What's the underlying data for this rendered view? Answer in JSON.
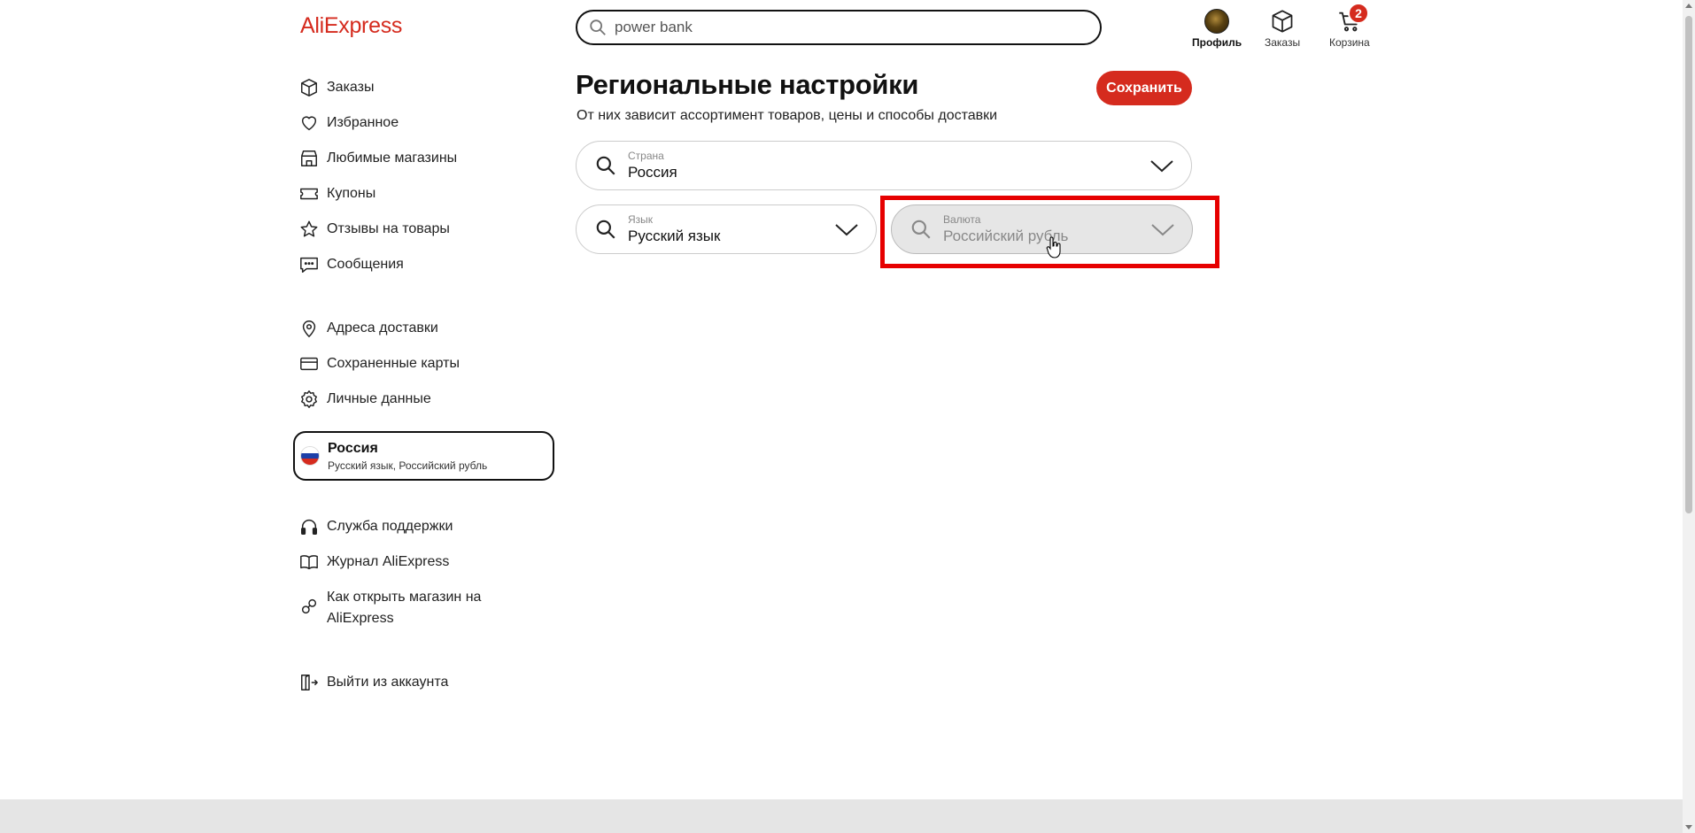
{
  "header": {
    "logo": "AliExpress",
    "search_value": "power bank",
    "profile_label": "Профиль",
    "orders_label": "Заказы",
    "cart_label": "Корзина",
    "cart_count": "2"
  },
  "sidebar": {
    "group1": [
      {
        "label": "Заказы",
        "icon": "box-icon"
      },
      {
        "label": "Избранное",
        "icon": "heart-icon"
      },
      {
        "label": "Любимые магазины",
        "icon": "store-icon"
      },
      {
        "label": "Купоны",
        "icon": "coupon-icon"
      },
      {
        "label": "Отзывы на товары",
        "icon": "star-icon"
      },
      {
        "label": "Сообщения",
        "icon": "chat-icon"
      }
    ],
    "group2": [
      {
        "label": "Адреса доставки",
        "icon": "location-pin-icon"
      },
      {
        "label": "Сохраненные карты",
        "icon": "card-icon"
      },
      {
        "label": "Личные данные",
        "icon": "gear-icon"
      }
    ],
    "region": {
      "title": "Россия",
      "subtitle": "Русский язык, Российский рубль"
    },
    "group3": [
      {
        "label": "Служба поддержки",
        "icon": "headphones-icon"
      },
      {
        "label": "Журнал AliExpress",
        "icon": "book-icon"
      },
      {
        "label": "Как открыть магазин на AliExpress",
        "icon": "link-icon"
      }
    ],
    "logout": {
      "label": "Выйти из аккаунта",
      "icon": "logout-icon"
    }
  },
  "main": {
    "title": "Региональные настройки",
    "subtitle": "От них зависит ассортимент товаров, цены и способы доставки",
    "save_label": "Сохранить",
    "country": {
      "label": "Страна",
      "value": "Россия"
    },
    "language": {
      "label": "Язык",
      "value": "Русский язык"
    },
    "currency": {
      "label": "Валюта",
      "value": "Российский рубль"
    }
  },
  "colors": {
    "accent": "#d52b1e",
    "highlight": "#e60000",
    "disabled_bg": "#e6e6e6"
  }
}
